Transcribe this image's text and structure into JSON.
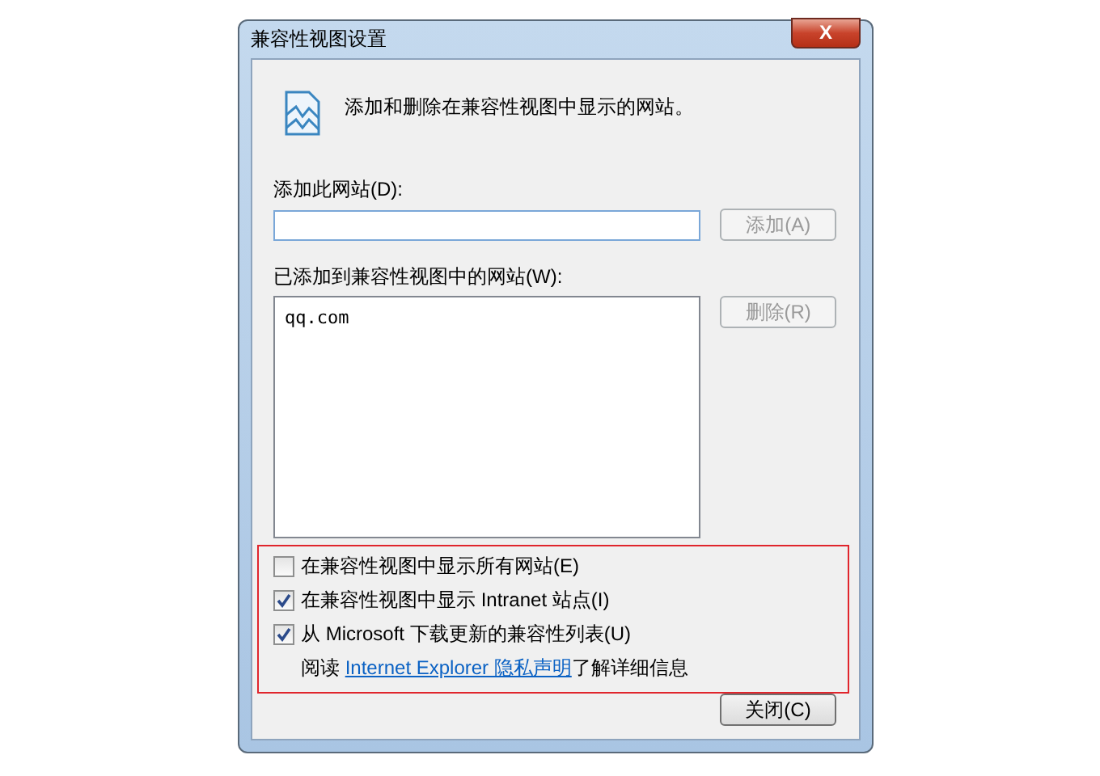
{
  "window": {
    "title": "兼容性视图设置",
    "close_label": "X"
  },
  "intro": "添加和删除在兼容性视图中显示的网站。",
  "add_site": {
    "label": "添加此网站(D):",
    "button": {
      "label": "添加(A)",
      "disabled": true
    }
  },
  "site_list": {
    "label": "已添加到兼容性视图中的网站(W):",
    "items": [
      {
        "text": "qq.com",
        "selected": false
      }
    ],
    "button": {
      "label": "删除(R)",
      "disabled": true
    }
  },
  "options": [
    {
      "label": "在兼容性视图中显示所有网站(E)",
      "checked": false
    },
    {
      "label": "在兼容性视图中显示 Intranet 站点(I)",
      "checked": true
    },
    {
      "label": "从 Microsoft 下载更新的兼容性列表(U)",
      "checked": true
    }
  ],
  "privacy_note": {
    "before": "阅读 ",
    "link": "Internet Explorer 隐私声明",
    "after": "了解详细信息"
  },
  "highlighted": true,
  "close_button": {
    "label": "关闭(C)",
    "disabled": false
  }
}
